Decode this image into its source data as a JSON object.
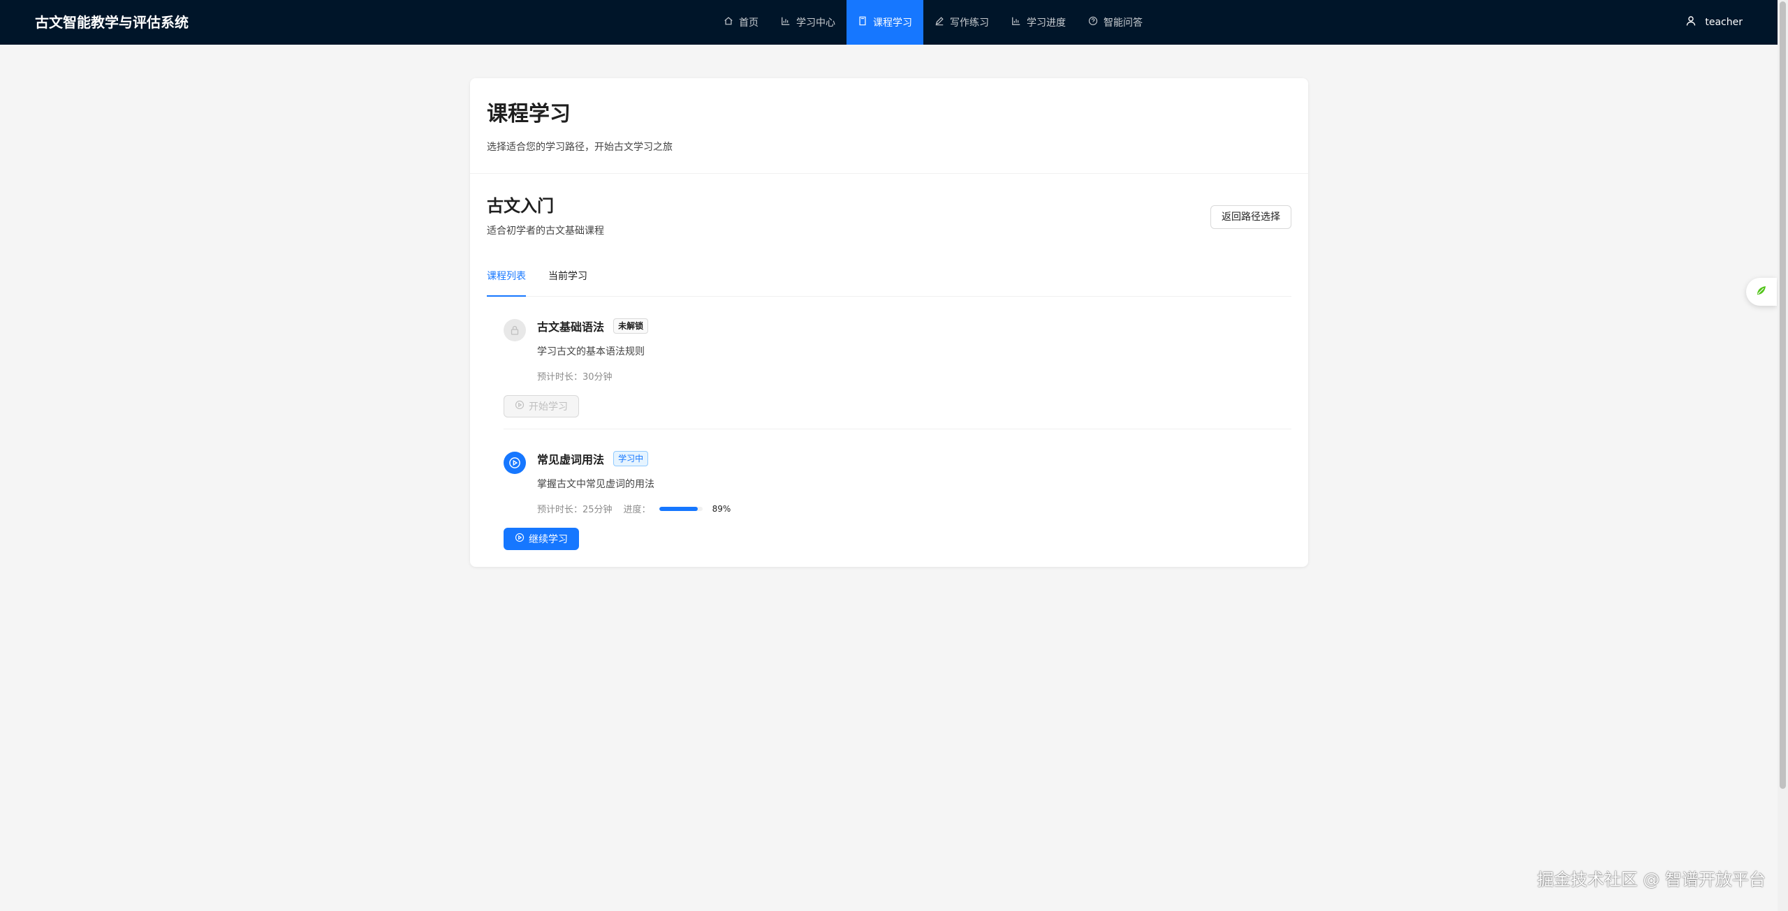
{
  "header": {
    "brand": "古文智能教学与评估系统",
    "nav": [
      {
        "label": "首页",
        "icon": "home-icon"
      },
      {
        "label": "学习中心",
        "icon": "bar-chart-icon"
      },
      {
        "label": "课程学习",
        "icon": "book-icon",
        "active": true
      },
      {
        "label": "写作练习",
        "icon": "edit-icon"
      },
      {
        "label": "学习进度",
        "icon": "bar-chart-icon"
      },
      {
        "label": "智能问答",
        "icon": "question-circle-icon"
      }
    ],
    "username": "teacher"
  },
  "page": {
    "title": "课程学习",
    "subtitle": "选择适合您的学习路径，开始古文学习之旅"
  },
  "path": {
    "title": "古文入门",
    "subtitle": "适合初学者的古文基础课程",
    "back_label": "返回路径选择"
  },
  "tabs": [
    {
      "label": "课程列表",
      "active": true
    },
    {
      "label": "当前学习",
      "active": false
    }
  ],
  "courses": [
    {
      "name": "古文基础语法",
      "status": "未解锁",
      "description": "学习古文的基本语法规则",
      "duration": "预计时长：30分钟",
      "button": "开始学习",
      "locked": true
    },
    {
      "name": "常见虚词用法",
      "status": "学习中",
      "description": "掌握古文中常见虚词的用法",
      "duration": "预计时长：25分钟",
      "progress_label": "进度：",
      "progress": 89,
      "progress_text": "89%",
      "button": "继续学习",
      "locked": false
    }
  ],
  "watermark": "掘金技术社区 @ 智谱开放平台",
  "colors": {
    "header_bg": "#001529",
    "primary": "#1677ff",
    "page_bg": "#f5f5f5"
  }
}
